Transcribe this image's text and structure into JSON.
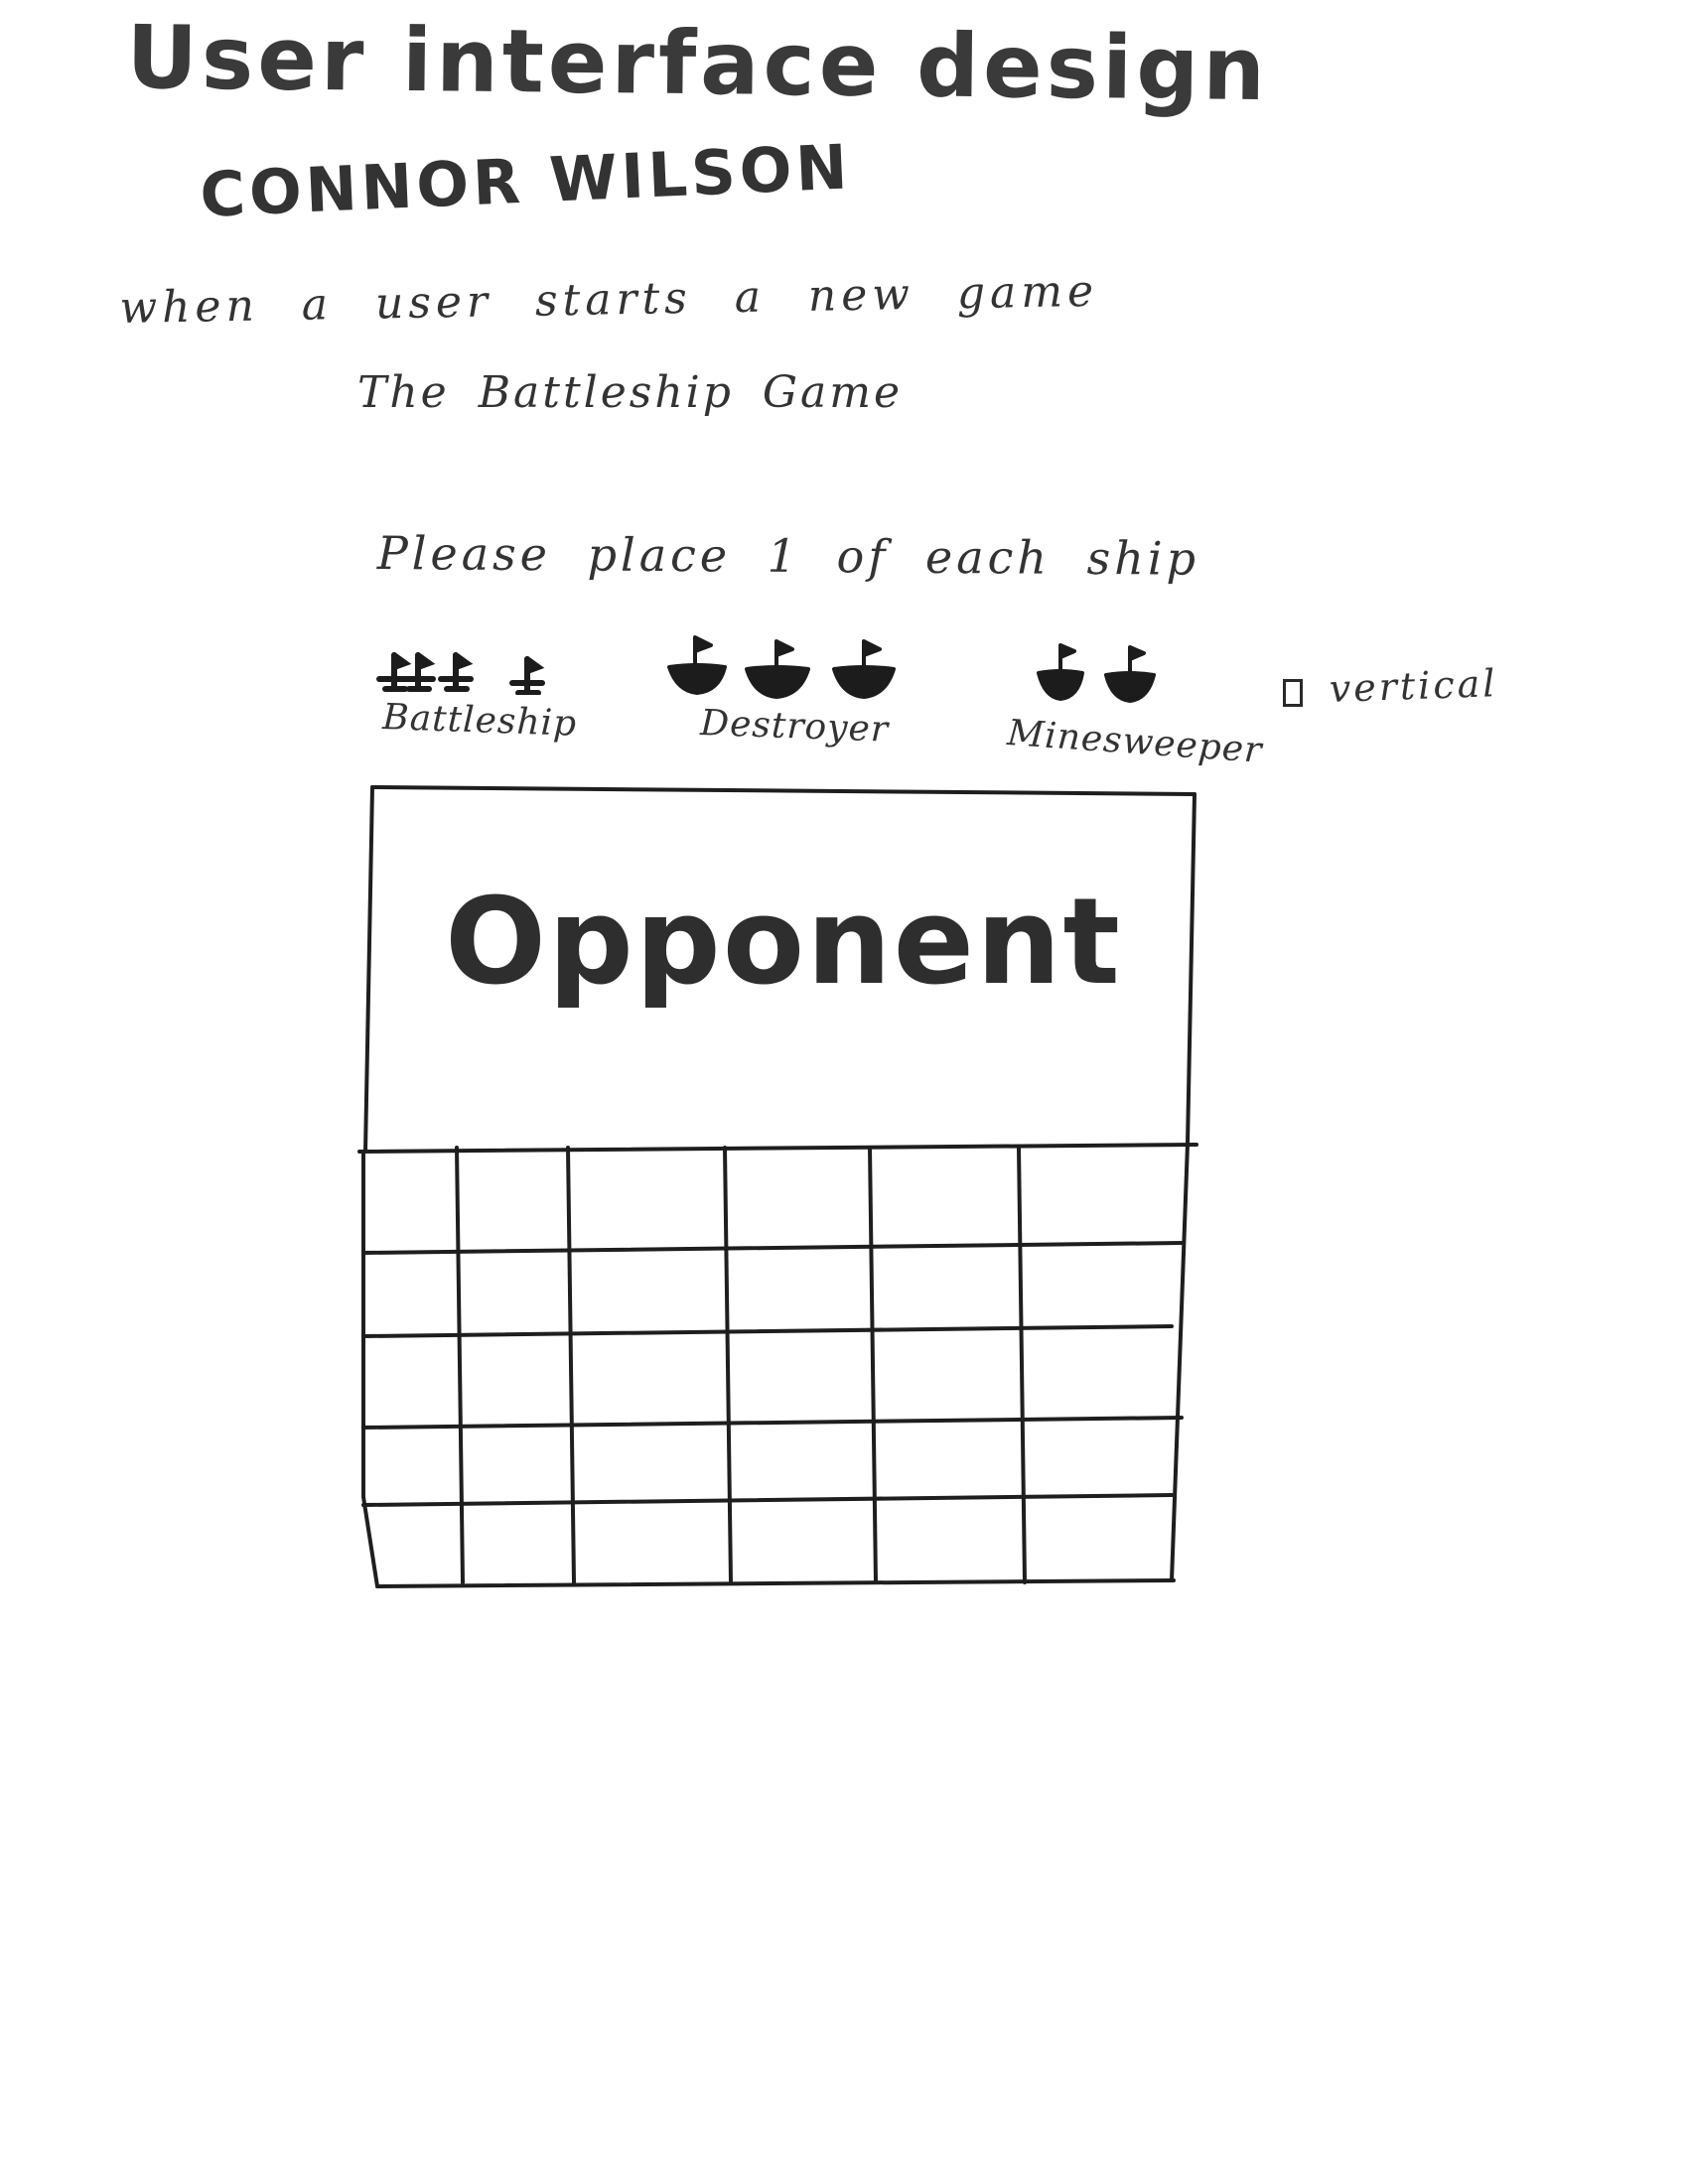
{
  "header": {
    "title": "User interface design",
    "author": "CONNOR WILSON"
  },
  "context": "when a user starts a new game",
  "game_title": "The Battleship Game",
  "instruction": "Please place 1 of each ship",
  "ships": [
    {
      "label": "Battleship",
      "icon": "battleship-icon",
      "count": 4
    },
    {
      "label": "Destroyer",
      "icon": "destroyer-icon",
      "count": 3
    },
    {
      "label": "Minesweeper",
      "icon": "minesweeper-icon",
      "count": 2
    }
  ],
  "vertical_option": {
    "label": "vertical",
    "checked": false
  },
  "board": {
    "opponent_label": "Opponent",
    "grid_rows": 5,
    "grid_cols": 6
  }
}
